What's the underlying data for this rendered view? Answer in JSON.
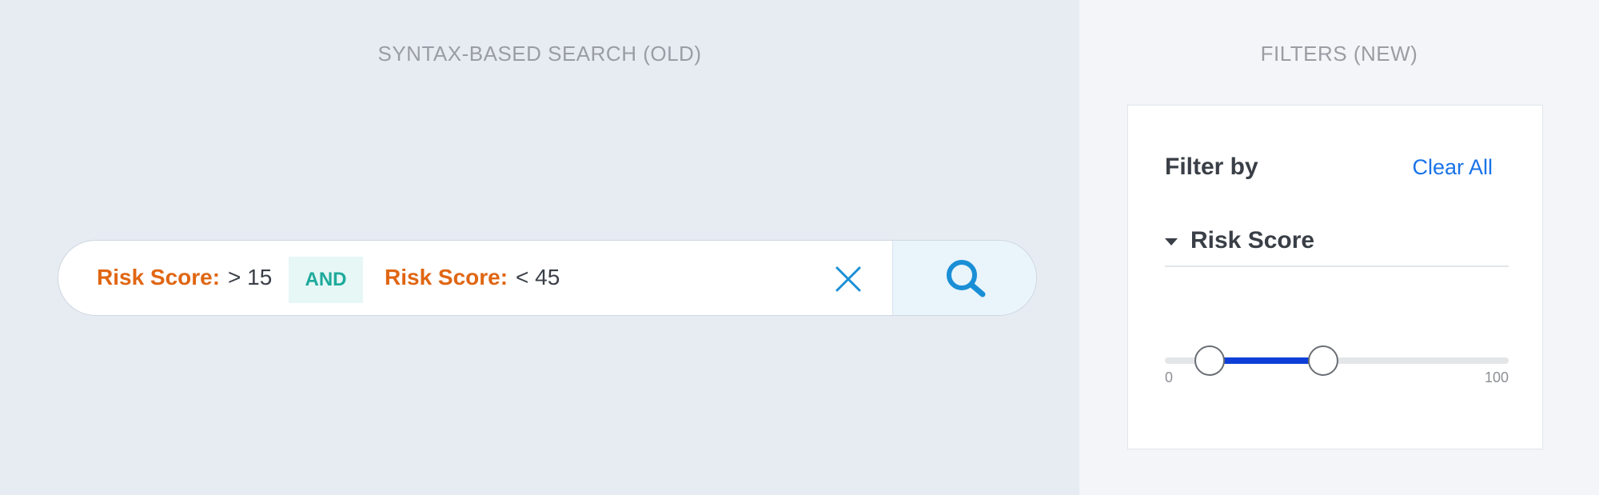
{
  "left_panel": {
    "title": "SYNTAX-BASED SEARCH (OLD)",
    "search": {
      "tokens": [
        {
          "field": "Risk Score:",
          "value": "> 15"
        },
        {
          "field": "Risk Score:",
          "value": "< 45"
        }
      ],
      "operator": "AND",
      "icons": {
        "clear": "close-icon",
        "submit": "search-icon"
      }
    }
  },
  "right_panel": {
    "title": "FILTERS (NEW)",
    "filter_card": {
      "heading": "Filter by",
      "clear_all": "Clear All",
      "section": {
        "label": "Risk Score",
        "icon": "caret-down-icon"
      },
      "slider": {
        "min_label": "0",
        "max_label": "100",
        "min": 0,
        "max": 100,
        "low": 13,
        "high": 46
      }
    }
  },
  "colors": {
    "field": "#e06612",
    "operator": "#1daa9b",
    "link": "#1a73e8",
    "range": "#0d3fd8",
    "search_icon": "#1a8fd6"
  }
}
